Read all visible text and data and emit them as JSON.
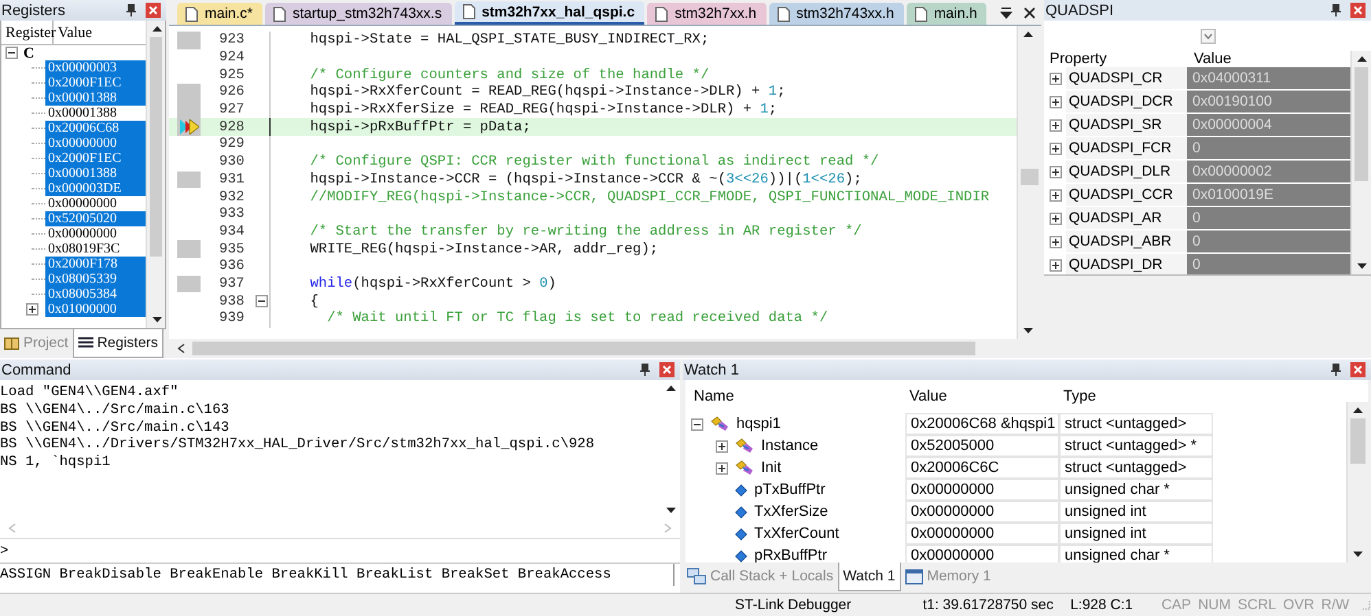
{
  "registers_panel": {
    "title": "Registers",
    "columns": [
      "Register",
      "Value"
    ],
    "root": {
      "label": "C",
      "expanded": true,
      "children": [
        {
          "value": "0x00000003",
          "selected": true
        },
        {
          "value": "0x2000F1EC",
          "selected": true
        },
        {
          "value": "0x00001388",
          "selected": true
        },
        {
          "value": "0x00001388",
          "selected": false
        },
        {
          "value": "0x20006C68",
          "selected": true
        },
        {
          "value": "0x00000000",
          "selected": true
        },
        {
          "value": "0x2000F1EC",
          "selected": true
        },
        {
          "value": "0x00001388",
          "selected": true
        },
        {
          "value": "0x000003DE",
          "selected": true
        },
        {
          "value": "0x00000000",
          "selected": false
        },
        {
          "value": "0x52005020",
          "selected": true
        },
        {
          "value": "0x00000000",
          "selected": false
        },
        {
          "value": "0x08019F3C",
          "selected": false
        },
        {
          "value": "0x2000F178",
          "selected": true
        },
        {
          "value": "0x08005339",
          "selected": true
        },
        {
          "value": "0x08005384",
          "selected": true
        },
        {
          "value": "0x01000000",
          "selected": true,
          "kind": "group",
          "expanded": false
        }
      ]
    },
    "tabs": [
      {
        "label": "Project",
        "selected": false,
        "kind": "project"
      },
      {
        "label": "Registers",
        "selected": true,
        "kind": "registers"
      }
    ]
  },
  "editor": {
    "tabs": [
      {
        "label": "main.c*",
        "selected": false,
        "color": "#f7e3a0"
      },
      {
        "label": "startup_stm32h743xx.s",
        "selected": false,
        "color": "#d8cde0"
      },
      {
        "label": "stm32h7xx_hal_qspi.c",
        "selected": true,
        "color": "#dbe7f5"
      },
      {
        "label": "stm32h7xx.h",
        "selected": false,
        "color": "#e8c6d6"
      },
      {
        "label": "stm32h743xx.h",
        "selected": false,
        "color": "#bdd2e6"
      },
      {
        "label": "main.h",
        "selected": false,
        "color": "#b8d6c8"
      }
    ],
    "lines": [
      {
        "number": "923",
        "executable": true,
        "current": false,
        "fold": false,
        "code": [
          {
            "kind": "plain",
            "text": "    hqspi->State = HAL_QSPI_STATE_BUSY_INDIRECT_RX;"
          }
        ]
      },
      {
        "number": "924",
        "executable": false,
        "current": false,
        "fold": false
      },
      {
        "number": "925",
        "executable": false,
        "current": false,
        "fold": false,
        "code": [
          {
            "kind": "comment",
            "text": "    /* Configure counters and size of the handle */"
          }
        ]
      },
      {
        "number": "926",
        "executable": true,
        "current": false,
        "fold": false,
        "code": [
          {
            "kind": "plain",
            "text": "    hqspi->RxXferCount = READ_REG(hqspi->Instance->DLR) + "
          },
          {
            "kind": "number",
            "text": "1"
          },
          {
            "kind": "plain",
            "text": ";"
          }
        ]
      },
      {
        "number": "927",
        "executable": true,
        "current": false,
        "fold": false,
        "code": [
          {
            "kind": "plain",
            "text": "    hqspi->RxXferSize = READ_REG(hqspi->Instance->DLR) + "
          },
          {
            "kind": "number",
            "text": "1"
          },
          {
            "kind": "plain",
            "text": ";"
          }
        ]
      },
      {
        "number": "928",
        "executable": true,
        "current": true,
        "fold": false,
        "code": [
          {
            "kind": "plain",
            "text": "    hqspi->pRxBuffPtr = pData;"
          }
        ]
      },
      {
        "number": "929",
        "executable": false,
        "current": false,
        "fold": false
      },
      {
        "number": "930",
        "executable": false,
        "current": false,
        "fold": false,
        "code": [
          {
            "kind": "comment",
            "text": "    /* Configure QSPI: CCR register with functional as indirect read */"
          }
        ]
      },
      {
        "number": "931",
        "executable": true,
        "current": false,
        "fold": false,
        "code": [
          {
            "kind": "plain",
            "text": "    hqspi->Instance->CCR = (hqspi->Instance->CCR & ~("
          },
          {
            "kind": "number",
            "text": "3<<26"
          },
          {
            "kind": "plain",
            "text": "))|("
          },
          {
            "kind": "number",
            "text": "1<<26"
          },
          {
            "kind": "plain",
            "text": ");"
          }
        ]
      },
      {
        "number": "932",
        "executable": false,
        "current": false,
        "fold": false,
        "code": [
          {
            "kind": "comment",
            "text": "    //MODIFY_REG(hqspi->Instance->CCR, QUADSPI_CCR_FMODE, QSPI_FUNCTIONAL_MODE_INDIR"
          }
        ]
      },
      {
        "number": "933",
        "executable": false,
        "current": false,
        "fold": false
      },
      {
        "number": "934",
        "executable": false,
        "current": false,
        "fold": false,
        "code": [
          {
            "kind": "comment",
            "text": "    /* Start the transfer by re-writing the address in AR register */"
          }
        ]
      },
      {
        "number": "935",
        "executable": true,
        "current": false,
        "fold": false,
        "code": [
          {
            "kind": "plain",
            "text": "    WRITE_REG(hqspi->Instance->AR, addr_reg);"
          }
        ]
      },
      {
        "number": "936",
        "executable": false,
        "current": false,
        "fold": false
      },
      {
        "number": "937",
        "executable": true,
        "current": false,
        "fold": false,
        "code": [
          {
            "kind": "keyword",
            "text": "    while"
          },
          {
            "kind": "plain",
            "text": "(hqspi->RxXferCount > "
          },
          {
            "kind": "number",
            "text": "0"
          },
          {
            "kind": "plain",
            "text": ")"
          }
        ]
      },
      {
        "number": "938",
        "executable": false,
        "current": false,
        "fold": true,
        "code": [
          {
            "kind": "plain",
            "text": "    {"
          }
        ]
      },
      {
        "number": "939",
        "executable": false,
        "current": false,
        "fold": false,
        "code": [
          {
            "kind": "comment",
            "text": "      /* Wait until FT or TC flag is set to read received data */"
          }
        ]
      }
    ]
  },
  "quadspi_panel": {
    "title": "QUADSPI",
    "columns": [
      "Property",
      "Value"
    ],
    "rows": [
      {
        "name": "QUADSPI_CR",
        "value": "0x04000311",
        "expanded": false
      },
      {
        "name": "QUADSPI_DCR",
        "value": "0x00190100",
        "expanded": false
      },
      {
        "name": "QUADSPI_SR",
        "value": "0x00000004",
        "expanded": false
      },
      {
        "name": "QUADSPI_FCR",
        "value": "0",
        "expanded": false
      },
      {
        "name": "QUADSPI_DLR",
        "value": "0x00000002",
        "expanded": false
      },
      {
        "name": "QUADSPI_CCR",
        "value": "0x0100019E",
        "expanded": false
      },
      {
        "name": "QUADSPI_AR",
        "value": "0",
        "expanded": false
      },
      {
        "name": "QUADSPI_ABR",
        "value": "0",
        "expanded": false
      },
      {
        "name": "QUADSPI_DR",
        "value": "0",
        "expanded": false
      }
    ]
  },
  "command_panel": {
    "title": "Command",
    "lines": [
      "Load \"GEN4\\\\GEN4.axf\"",
      "BS \\\\GEN4\\../Src/main.c\\163",
      "BS \\\\GEN4\\../Src/main.c\\143",
      "BS \\\\GEN4\\../Drivers/STM32H7xx_HAL_Driver/Src/stm32h7xx_hal_qspi.c\\928",
      "NS 1, `hqspi1"
    ],
    "prompt": ">",
    "help": "ASSIGN BreakDisable BreakEnable BreakKill BreakList BreakSet BreakAccess"
  },
  "watch_panel": {
    "title": "Watch 1",
    "columns": [
      "Name",
      "Value",
      "Type"
    ],
    "items": [
      {
        "name": "hqspi1",
        "value": "0x20006C68 &hqspi1",
        "type": "struct <untagged>",
        "kind": "struct",
        "expanded": true,
        "children": [
          {
            "name": "Instance",
            "value": "0x52005000",
            "type": "struct <untagged> *",
            "kind": "struct",
            "expanded": false
          },
          {
            "name": "Init",
            "value": "0x20006C6C",
            "type": "struct <untagged>",
            "kind": "struct",
            "expanded": false
          },
          {
            "name": "pTxBuffPtr",
            "value": "0x00000000",
            "type": "unsigned char *",
            "kind": "member"
          },
          {
            "name": "TxXferSize",
            "value": "0x00000000",
            "type": "unsigned int",
            "kind": "member"
          },
          {
            "name": "TxXferCount",
            "value": "0x00000000",
            "type": "unsigned int",
            "kind": "member"
          },
          {
            "name": "pRxBuffPtr",
            "value": "0x00000000",
            "type": "unsigned char *",
            "kind": "member"
          }
        ]
      }
    ],
    "tabs": [
      {
        "label": "Call Stack + Locals",
        "selected": false,
        "kind": "callstack"
      },
      {
        "label": "Watch 1",
        "selected": true,
        "kind": "watch"
      },
      {
        "label": "Memory 1",
        "selected": false,
        "kind": "memory"
      }
    ]
  },
  "status_bar": {
    "debugger": "ST-Link Debugger",
    "time": "t1: 39.61728750 sec",
    "position": "L:928 C:1",
    "indicators": [
      "CAP",
      "NUM",
      "SCRL",
      "OVR",
      "R/W"
    ]
  }
}
